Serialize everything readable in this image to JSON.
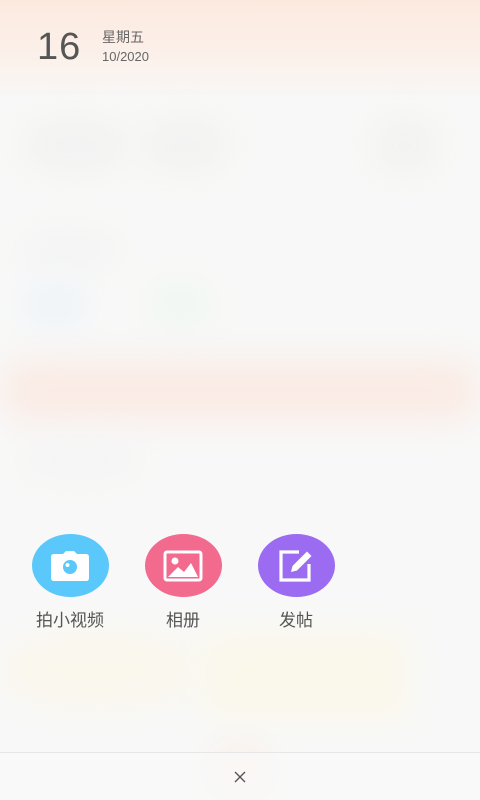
{
  "date": {
    "day": "16",
    "weekday": "星期五",
    "month_year": "10/2020"
  },
  "actions": [
    {
      "label": "拍小视频",
      "icon": "camera-icon",
      "color": "#5ac8fa"
    },
    {
      "label": "相册",
      "icon": "image-icon",
      "color": "#f26a8d"
    },
    {
      "label": "发帖",
      "icon": "edit-icon",
      "color": "#9b6bf2"
    }
  ],
  "bottom_bar": {
    "close_icon": "close-icon"
  }
}
